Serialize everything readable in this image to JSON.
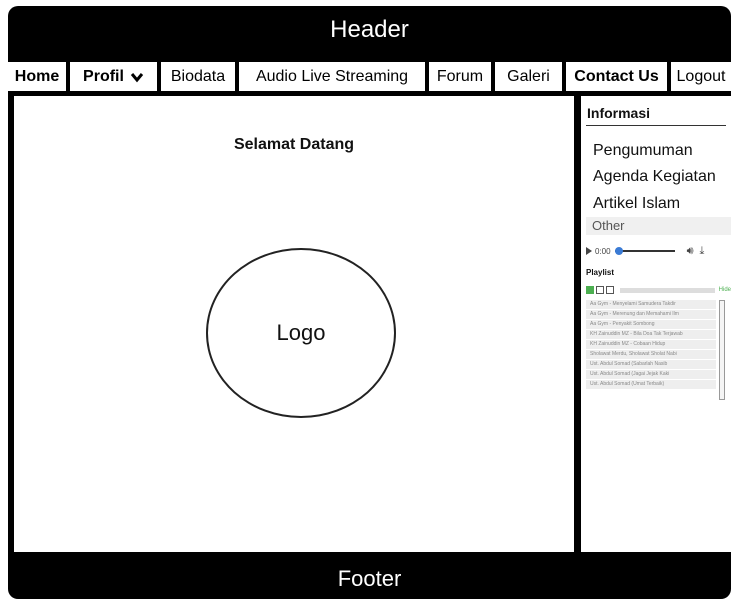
{
  "header": {
    "title": "Header"
  },
  "nav": {
    "items": [
      {
        "label": "Home"
      },
      {
        "label": "Profil"
      },
      {
        "label": "Biodata"
      },
      {
        "label": "Audio Live Streaming"
      },
      {
        "label": "Forum"
      },
      {
        "label": "Galeri"
      },
      {
        "label": "Contact Us"
      },
      {
        "label": "Logout"
      }
    ]
  },
  "main": {
    "welcome": "Selamat Datang",
    "logo_text": "Logo"
  },
  "sidebar": {
    "title": "Informasi",
    "links": [
      "Pengumuman",
      "Agenda Kegiatan",
      "Artikel Islam"
    ],
    "other": "Other",
    "player": {
      "time": "0:00"
    },
    "playlist_label": "Playlist",
    "playlist_tag": "Hide",
    "playlist": [
      "Aa Gym - Menyelami Samudera Takdir",
      "Aa Gym - Merenung dan Memahami Ilm",
      "Aa Gym - Penyakit Sombong",
      "KH Zainuddin MZ - Bila Doa Tak Terjawab",
      "KH Zainuddin MZ - Cobaan Hidup",
      "Sholawat Merdu, Sholawat Sholat Nabi",
      "Ust. Abdul Somad (Sabarlah Nasib",
      "Ust. Abdul Somad (Jagai Jejak Kaki",
      "Ust. Abdul Somad (Umat Terbaik)"
    ]
  },
  "footer": {
    "title": "Footer"
  }
}
